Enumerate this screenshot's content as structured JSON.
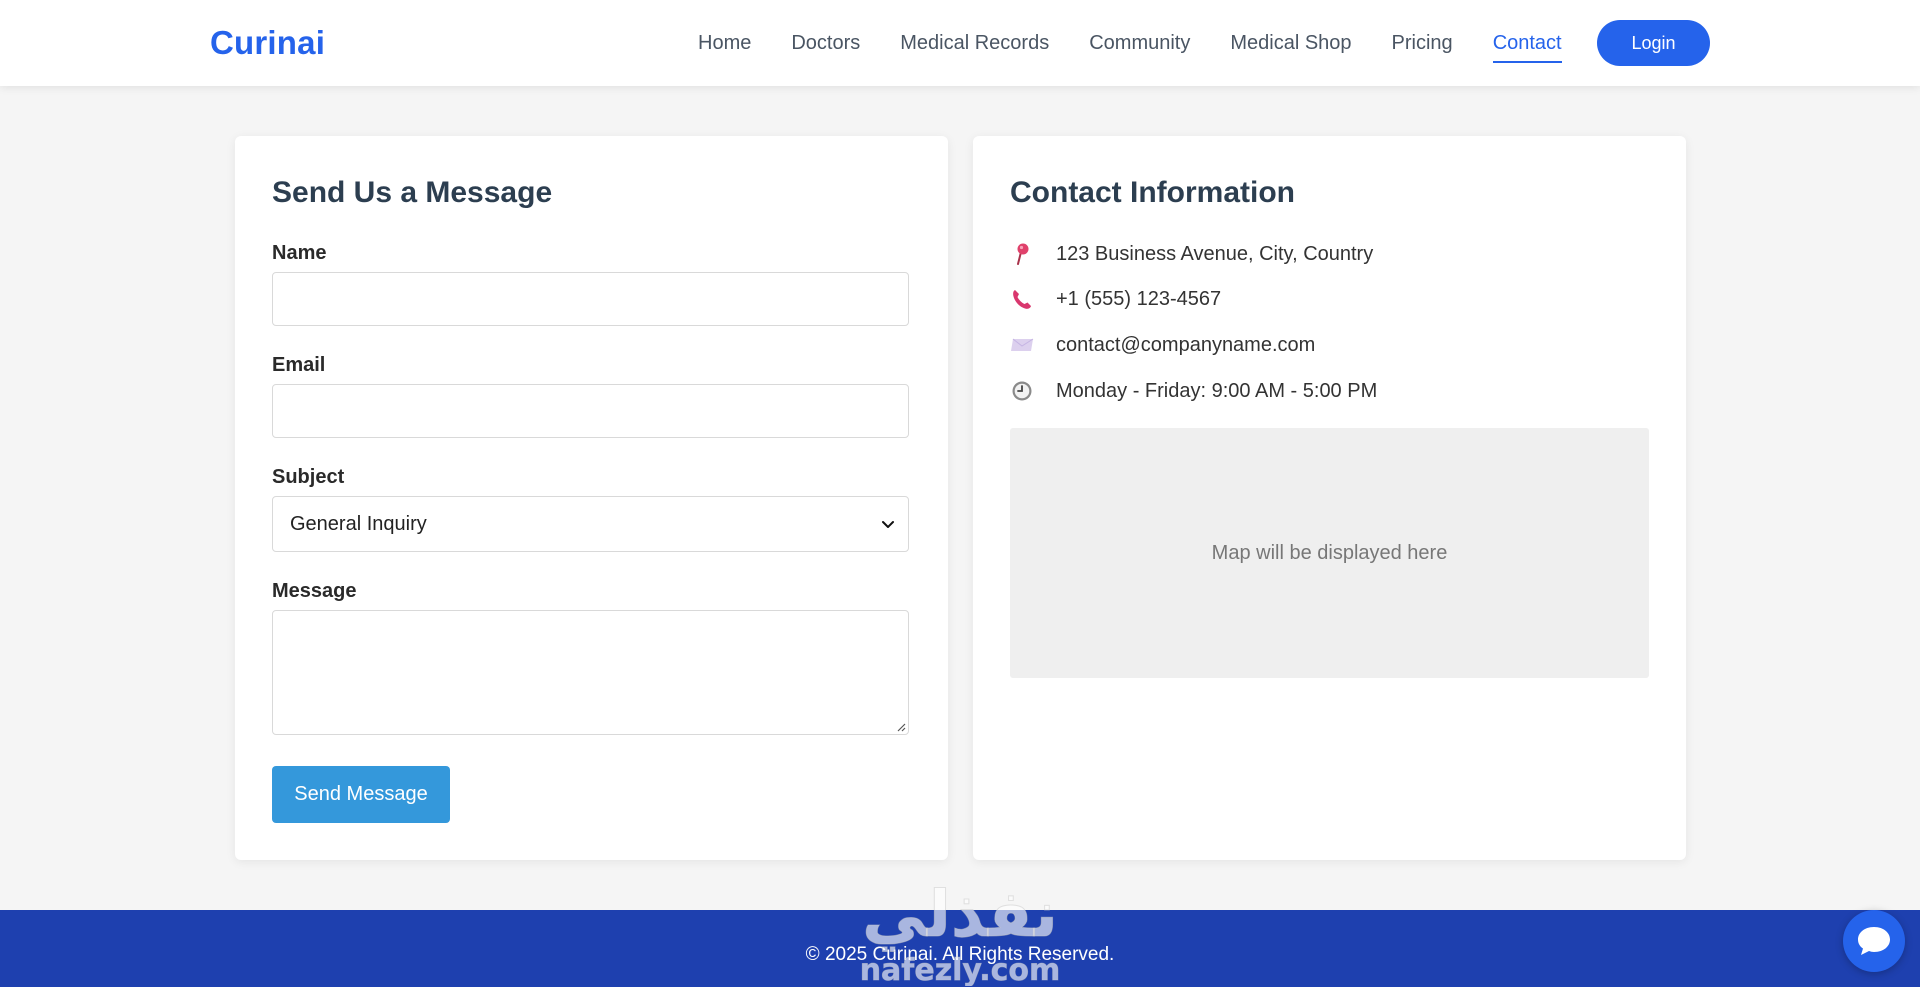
{
  "header": {
    "logo": "Curinai",
    "nav": [
      {
        "label": "Home"
      },
      {
        "label": "Doctors"
      },
      {
        "label": "Medical Records"
      },
      {
        "label": "Community"
      },
      {
        "label": "Medical Shop"
      },
      {
        "label": "Pricing"
      },
      {
        "label": "Contact",
        "active": true
      }
    ],
    "login_label": "Login"
  },
  "form": {
    "title": "Send Us a Message",
    "name_label": "Name",
    "name_value": "",
    "email_label": "Email",
    "email_value": "",
    "subject_label": "Subject",
    "subject_selected": "General Inquiry",
    "message_label": "Message",
    "message_value": "",
    "submit_label": "Send Message"
  },
  "contact": {
    "title": "Contact Information",
    "items": [
      {
        "icon": "map-pin-icon",
        "text": "123 Business Avenue, City, Country"
      },
      {
        "icon": "phone-icon",
        "text": "+1 (555) 123-4567"
      },
      {
        "icon": "envelope-icon",
        "text": "contact@companyname.com"
      },
      {
        "icon": "clock-icon",
        "text": "Monday - Friday: 9:00 AM - 5:00 PM"
      }
    ],
    "map_placeholder": "Map will be displayed here"
  },
  "footer": {
    "copyright": "© 2025 Curinai. All Rights Reserved."
  },
  "watermark": {
    "arabic": "نفذلي",
    "latin": "nafezly.com"
  },
  "colors": {
    "brand": "#2563eb",
    "button": "#3498db",
    "footer": "#1e40af",
    "background": "#f5f5f5"
  }
}
